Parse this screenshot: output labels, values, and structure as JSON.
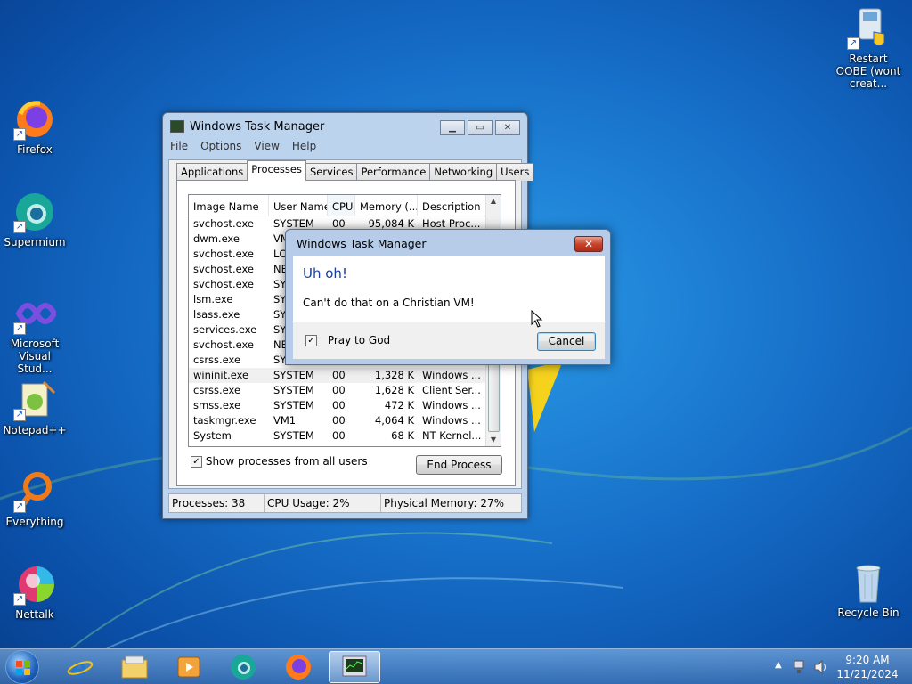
{
  "desktop": {
    "icons": [
      {
        "label": "Firefox"
      },
      {
        "label": "Supermium"
      },
      {
        "label": "Microsoft Visual Stud..."
      },
      {
        "label": "Notepad++"
      },
      {
        "label": "Everything"
      },
      {
        "label": "Nettalk"
      },
      {
        "label": "Restart OOBE (wont creat..."
      },
      {
        "label": "Recycle Bin"
      }
    ]
  },
  "taskmgr": {
    "title": "Windows Task Manager",
    "menu": [
      "File",
      "Options",
      "View",
      "Help"
    ],
    "tabs": [
      "Applications",
      "Processes",
      "Services",
      "Performance",
      "Networking",
      "Users"
    ],
    "active_tab": "Processes",
    "columns": [
      "Image Name",
      "User Name",
      "CPU",
      "Memory (...",
      "Description"
    ],
    "rows": [
      [
        "svchost.exe",
        "SYSTEM",
        "00",
        "95,084 K",
        "Host Proc..."
      ],
      [
        "dwm.exe",
        "VM",
        "",
        "",
        ""
      ],
      [
        "svchost.exe",
        "LC",
        "",
        "",
        ""
      ],
      [
        "svchost.exe",
        "NE",
        "",
        "",
        ""
      ],
      [
        "svchost.exe",
        "SY",
        "",
        "",
        ""
      ],
      [
        "lsm.exe",
        "SY",
        "",
        "",
        ""
      ],
      [
        "lsass.exe",
        "SY",
        "",
        "",
        ""
      ],
      [
        "services.exe",
        "SY",
        "",
        "",
        ""
      ],
      [
        "svchost.exe",
        "NE",
        "",
        "",
        ""
      ],
      [
        "csrss.exe",
        "SY",
        "",
        "",
        ""
      ],
      [
        "wininit.exe",
        "SYSTEM",
        "00",
        "1,328 K",
        "Windows ..."
      ],
      [
        "csrss.exe",
        "SYSTEM",
        "00",
        "1,628 K",
        "Client Ser..."
      ],
      [
        "smss.exe",
        "SYSTEM",
        "00",
        "472 K",
        "Windows ..."
      ],
      [
        "taskmgr.exe",
        "VM1",
        "00",
        "4,064 K",
        "Windows ..."
      ],
      [
        "System",
        "SYSTEM",
        "00",
        "68 K",
        "NT Kernel..."
      ]
    ],
    "show_all_label": "Show processes from all users",
    "show_all_checked": true,
    "end_process_label": "End Process",
    "status": {
      "processes": "Processes: 38",
      "cpu": "CPU Usage: 2%",
      "memory": "Physical Memory: 27%"
    }
  },
  "dialog": {
    "title": "Windows Task Manager",
    "close_glyph": "✕",
    "heading": "Uh oh!",
    "message": "Can't do that on a Christian VM!",
    "checkbox_label": "Pray to God",
    "checkbox_checked": true,
    "cancel_label": "Cancel"
  },
  "taskbar": {
    "apps": [
      "start",
      "internet-explorer",
      "file-explorer",
      "media-player",
      "supermium",
      "firefox",
      "task-manager"
    ],
    "active_app": "task-manager",
    "clock_time": "9:20 AM",
    "clock_date": "11/21/2024"
  }
}
